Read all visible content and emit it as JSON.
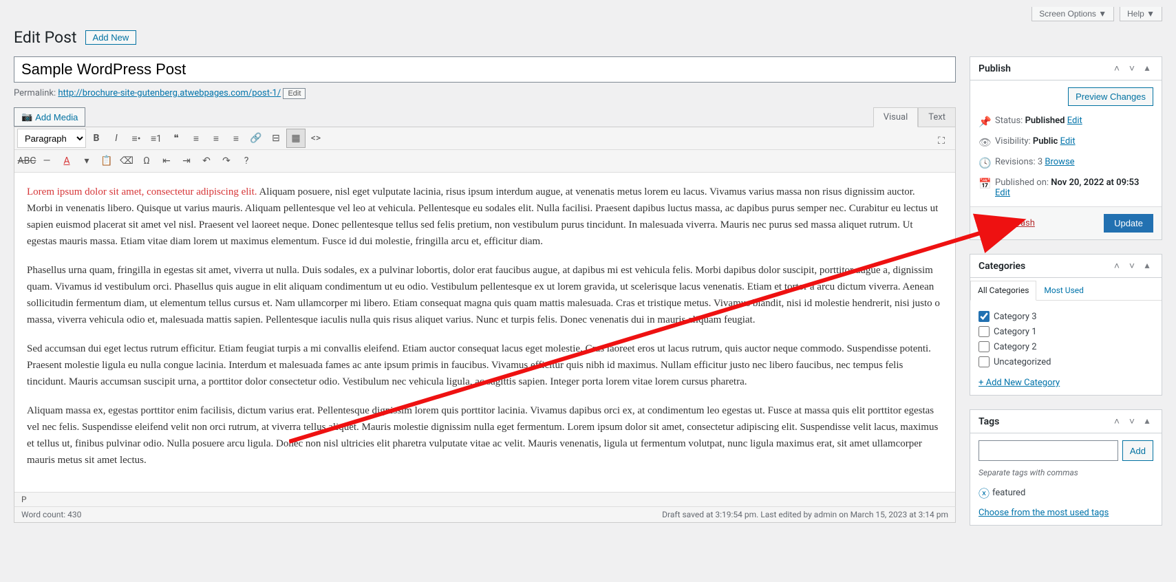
{
  "top": {
    "screen_options": "Screen Options ▼",
    "help": "Help ▼"
  },
  "page": {
    "title": "Edit Post",
    "add_new": "Add New"
  },
  "post": {
    "title": "Sample WordPress Post",
    "permalink_label": "Permalink:",
    "permalink_url": "http://brochure-site-gutenberg.atwebpages.com/post-1/",
    "permalink_edit": "Edit"
  },
  "editor": {
    "add_media": "Add Media",
    "tab_visual": "Visual",
    "tab_text": "Text",
    "format": "Paragraph",
    "status_path": "P",
    "word_count_label": "Word count: 430",
    "save_status": "Draft saved at 3:19:54 pm. Last edited by admin on March 15, 2023 at 3:14 pm",
    "p1_red": "Lorem ipsum dolor sit amet, consectetur adipiscing elit.",
    "p1_rest": " Aliquam posuere, nisl eget vulputate lacinia, risus ipsum interdum augue, at venenatis metus lorem eu lacus. Vivamus varius massa non risus dignissim auctor. Morbi in venenatis libero. Quisque ut varius mauris. Aliquam pellentesque vel leo at vehicula. Pellentesque eu sodales elit. Nulla facilisi. Praesent dapibus luctus massa, ac dapibus purus semper nec. Curabitur eu lectus ut sapien euismod placerat sit amet vel nisl. Praesent vel laoreet neque. Donec pellentesque tellus sed felis pretium, non vestibulum purus tincidunt. In malesuada viverra. Mauris nec purus sed massa aliquet rutrum. Ut egestas mauris massa. Etiam vitae diam lorem ut maximus elementum. Fusce id dui molestie, fringilla arcu et, efficitur diam.",
    "p2": "Phasellus urna quam, fringilla in egestas sit amet, viverra ut nulla. Duis sodales, ex a pulvinar lobortis, dolor erat faucibus augue, at dapibus mi est vehicula felis. Morbi dapibus dolor suscipit, porttitor augue a, dignissim quam. Vivamus id vestibulum orci. Phasellus quis augue in elit aliquam condimentum ut eu odio. Vestibulum pellentesque ex ut lorem gravida, ut scelerisque lacus venenatis. Etiam et tortor a arcu dictum viverra. Aenean sollicitudin fermentum diam, ut elementum tellus cursus et. Nam ullamcorper mi libero. Etiam consequat magna quis quam mattis malesuada. Cras et tristique metus. Vivamus blandit, nisi id molestie hendrerit, nisi justo o massa, viverra vehicula odio et, malesuada mattis sapien. Pellentesque iaculis nulla quis risus aliquet varius. Nunc et turpis felis. Donec venenatis dui in mauris aliquam feugiat.",
    "p3": "Sed accumsan dui eget lectus rutrum efficitur. Etiam feugiat turpis a mi convallis eleifend. Etiam auctor consequat lacus eget molestie. Cras laoreet eros ut lacus rutrum, quis auctor neque commodo. Suspendisse potenti. Praesent molestie ligula eu nulla congue lacinia. Interdum et malesuada fames ac ante ipsum primis in faucibus. Vivamus efficitur quis nibh id maximus. Nullam efficitur justo nec libero faucibus, nec tempus felis tincidunt. Mauris accumsan suscipit urna, a porttitor dolor consectetur odio. Vestibulum nec vehicula ligula, ac sagittis sapien. Integer porta lorem vitae lorem cursus pharetra.",
    "p4": "Aliquam massa ex, egestas porttitor enim facilisis, dictum varius erat. Pellentesque dignissim lorem quis porttitor lacinia. Vivamus dapibus orci ex, at condimentum leo egestas ut. Fusce at massa quis elit porttitor egestas vel nec felis. Suspendisse eleifend velit non orci rutrum, at viverra tellus aliquet. Mauris molestie dignissim nulla eget fermentum. Lorem ipsum dolor sit amet, consectetur adipiscing elit. Suspendisse velit lacus, maximus et tellus ut, finibus pulvinar odio. Nulla posuere arcu ligula. Donec non nisl ultricies elit pharetra vulputate vitae ac velit. Mauris venenatis, ligula ut fermentum volutpat, nunc ligula maximus erat, sit amet ullamcorper mauris metus sit amet lectus."
  },
  "publish": {
    "heading": "Publish",
    "preview": "Preview Changes",
    "status_label": "Status:",
    "status_value": "Published",
    "status_edit": "Edit",
    "visibility_label": "Visibility:",
    "visibility_value": "Public",
    "visibility_edit": "Edit",
    "revisions_label": "Revisions:",
    "revisions_value": "3",
    "revisions_browse": "Browse",
    "published_label": "Published on:",
    "published_value": "Nov 20, 2022 at 09:53",
    "published_edit": "Edit",
    "trash": "Move to Trash",
    "update": "Update"
  },
  "categories": {
    "heading": "Categories",
    "tab_all": "All Categories",
    "tab_used": "Most Used",
    "items": [
      {
        "label": "Category 3",
        "checked": true
      },
      {
        "label": "Category 1",
        "checked": false
      },
      {
        "label": "Category 2",
        "checked": false
      },
      {
        "label": "Uncategorized",
        "checked": false
      }
    ],
    "add_new": "+ Add New Category"
  },
  "tags": {
    "heading": "Tags",
    "add_btn": "Add",
    "hint": "Separate tags with commas",
    "existing": "featured",
    "choose": "Choose from the most used tags"
  }
}
